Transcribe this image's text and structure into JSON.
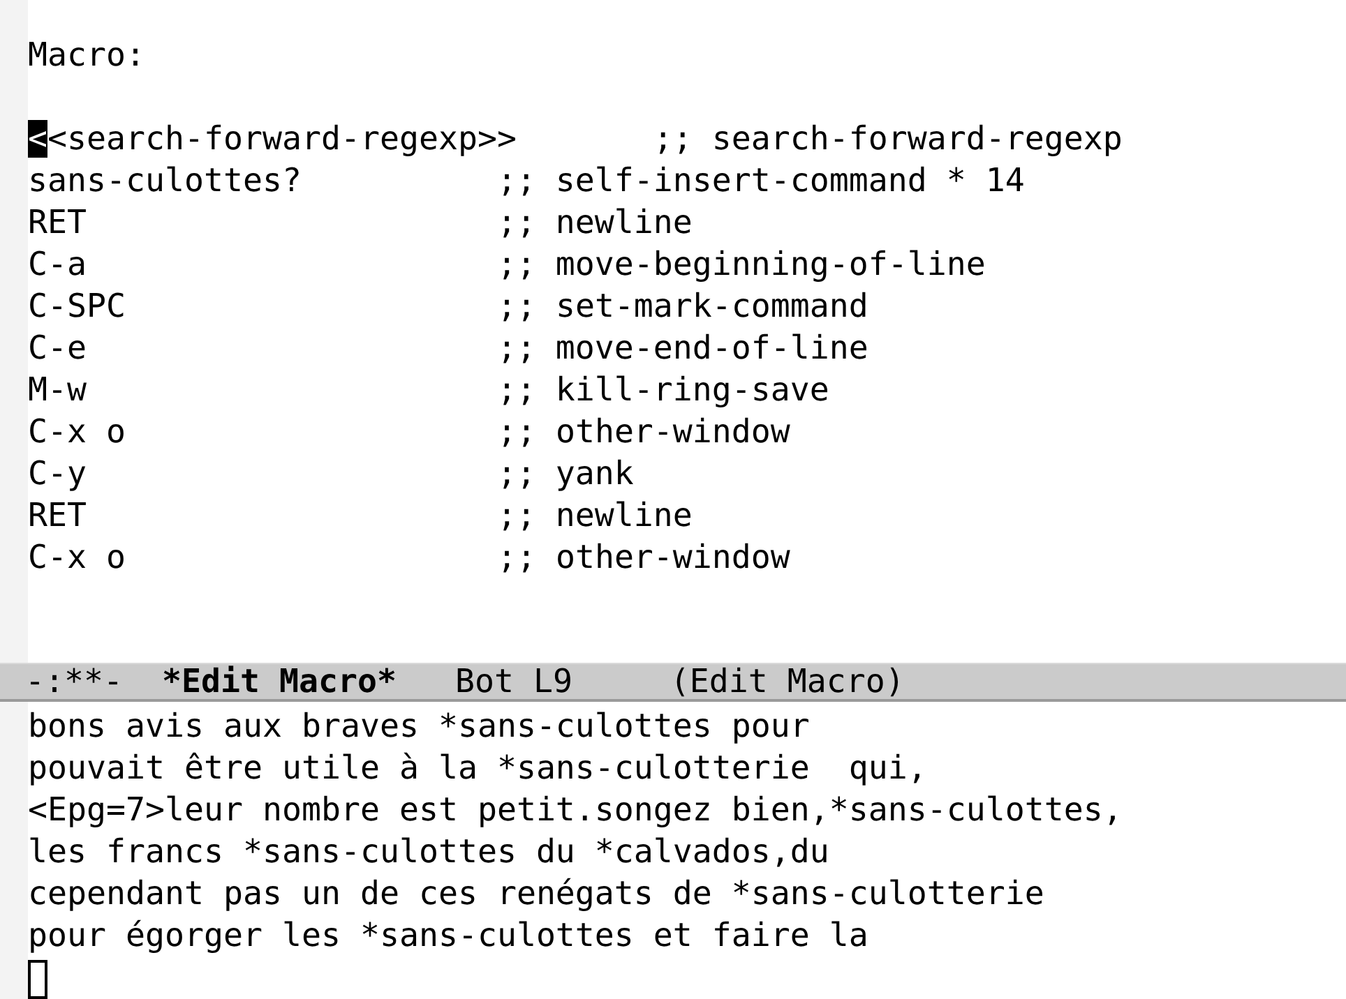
{
  "macro_window": {
    "heading": "Macro:",
    "selected": true,
    "lines": [
      {
        "key": "<<search-forward-regexp>>",
        "comment": ";; search-forward-regexp",
        "cursor": true
      },
      {
        "key": "sans-culottes?",
        "comment": ";; self-insert-command * 14",
        "cursor": false
      },
      {
        "key": "RET",
        "comment": ";; newline",
        "cursor": false
      },
      {
        "key": "C-a",
        "comment": ";; move-beginning-of-line",
        "cursor": false
      },
      {
        "key": "C-SPC",
        "comment": ";; set-mark-command",
        "cursor": false
      },
      {
        "key": "C-e",
        "comment": ";; move-end-of-line",
        "cursor": false
      },
      {
        "key": "M-w",
        "comment": ";; kill-ring-save",
        "cursor": false
      },
      {
        "key": "C-x o",
        "comment": ";; other-window",
        "cursor": false
      },
      {
        "key": "C-y",
        "comment": ";; yank",
        "cursor": false
      },
      {
        "key": "RET",
        "comment": ";; newline",
        "cursor": false
      },
      {
        "key": "C-x o",
        "comment": ";; other-window",
        "cursor": false
      }
    ]
  },
  "mode_line": {
    "status": "-:**-",
    "buffer_name": "*Edit Macro*",
    "position": "Bot L9",
    "mode": "(Edit Macro)"
  },
  "text_window": {
    "selected": false,
    "cursor": true,
    "lines": [
      "bons avis aux braves *sans-culottes pour",
      "pouvait être utile à la *sans-culotterie  qui,",
      "<Epg=7>leur nombre est petit.songez bien,*sans-culottes,",
      "les francs *sans-culottes du *calvados,du",
      "cependant pas un de ces renégats de *sans-culotterie",
      "pour égorger les *sans-culottes et faire la"
    ]
  }
}
